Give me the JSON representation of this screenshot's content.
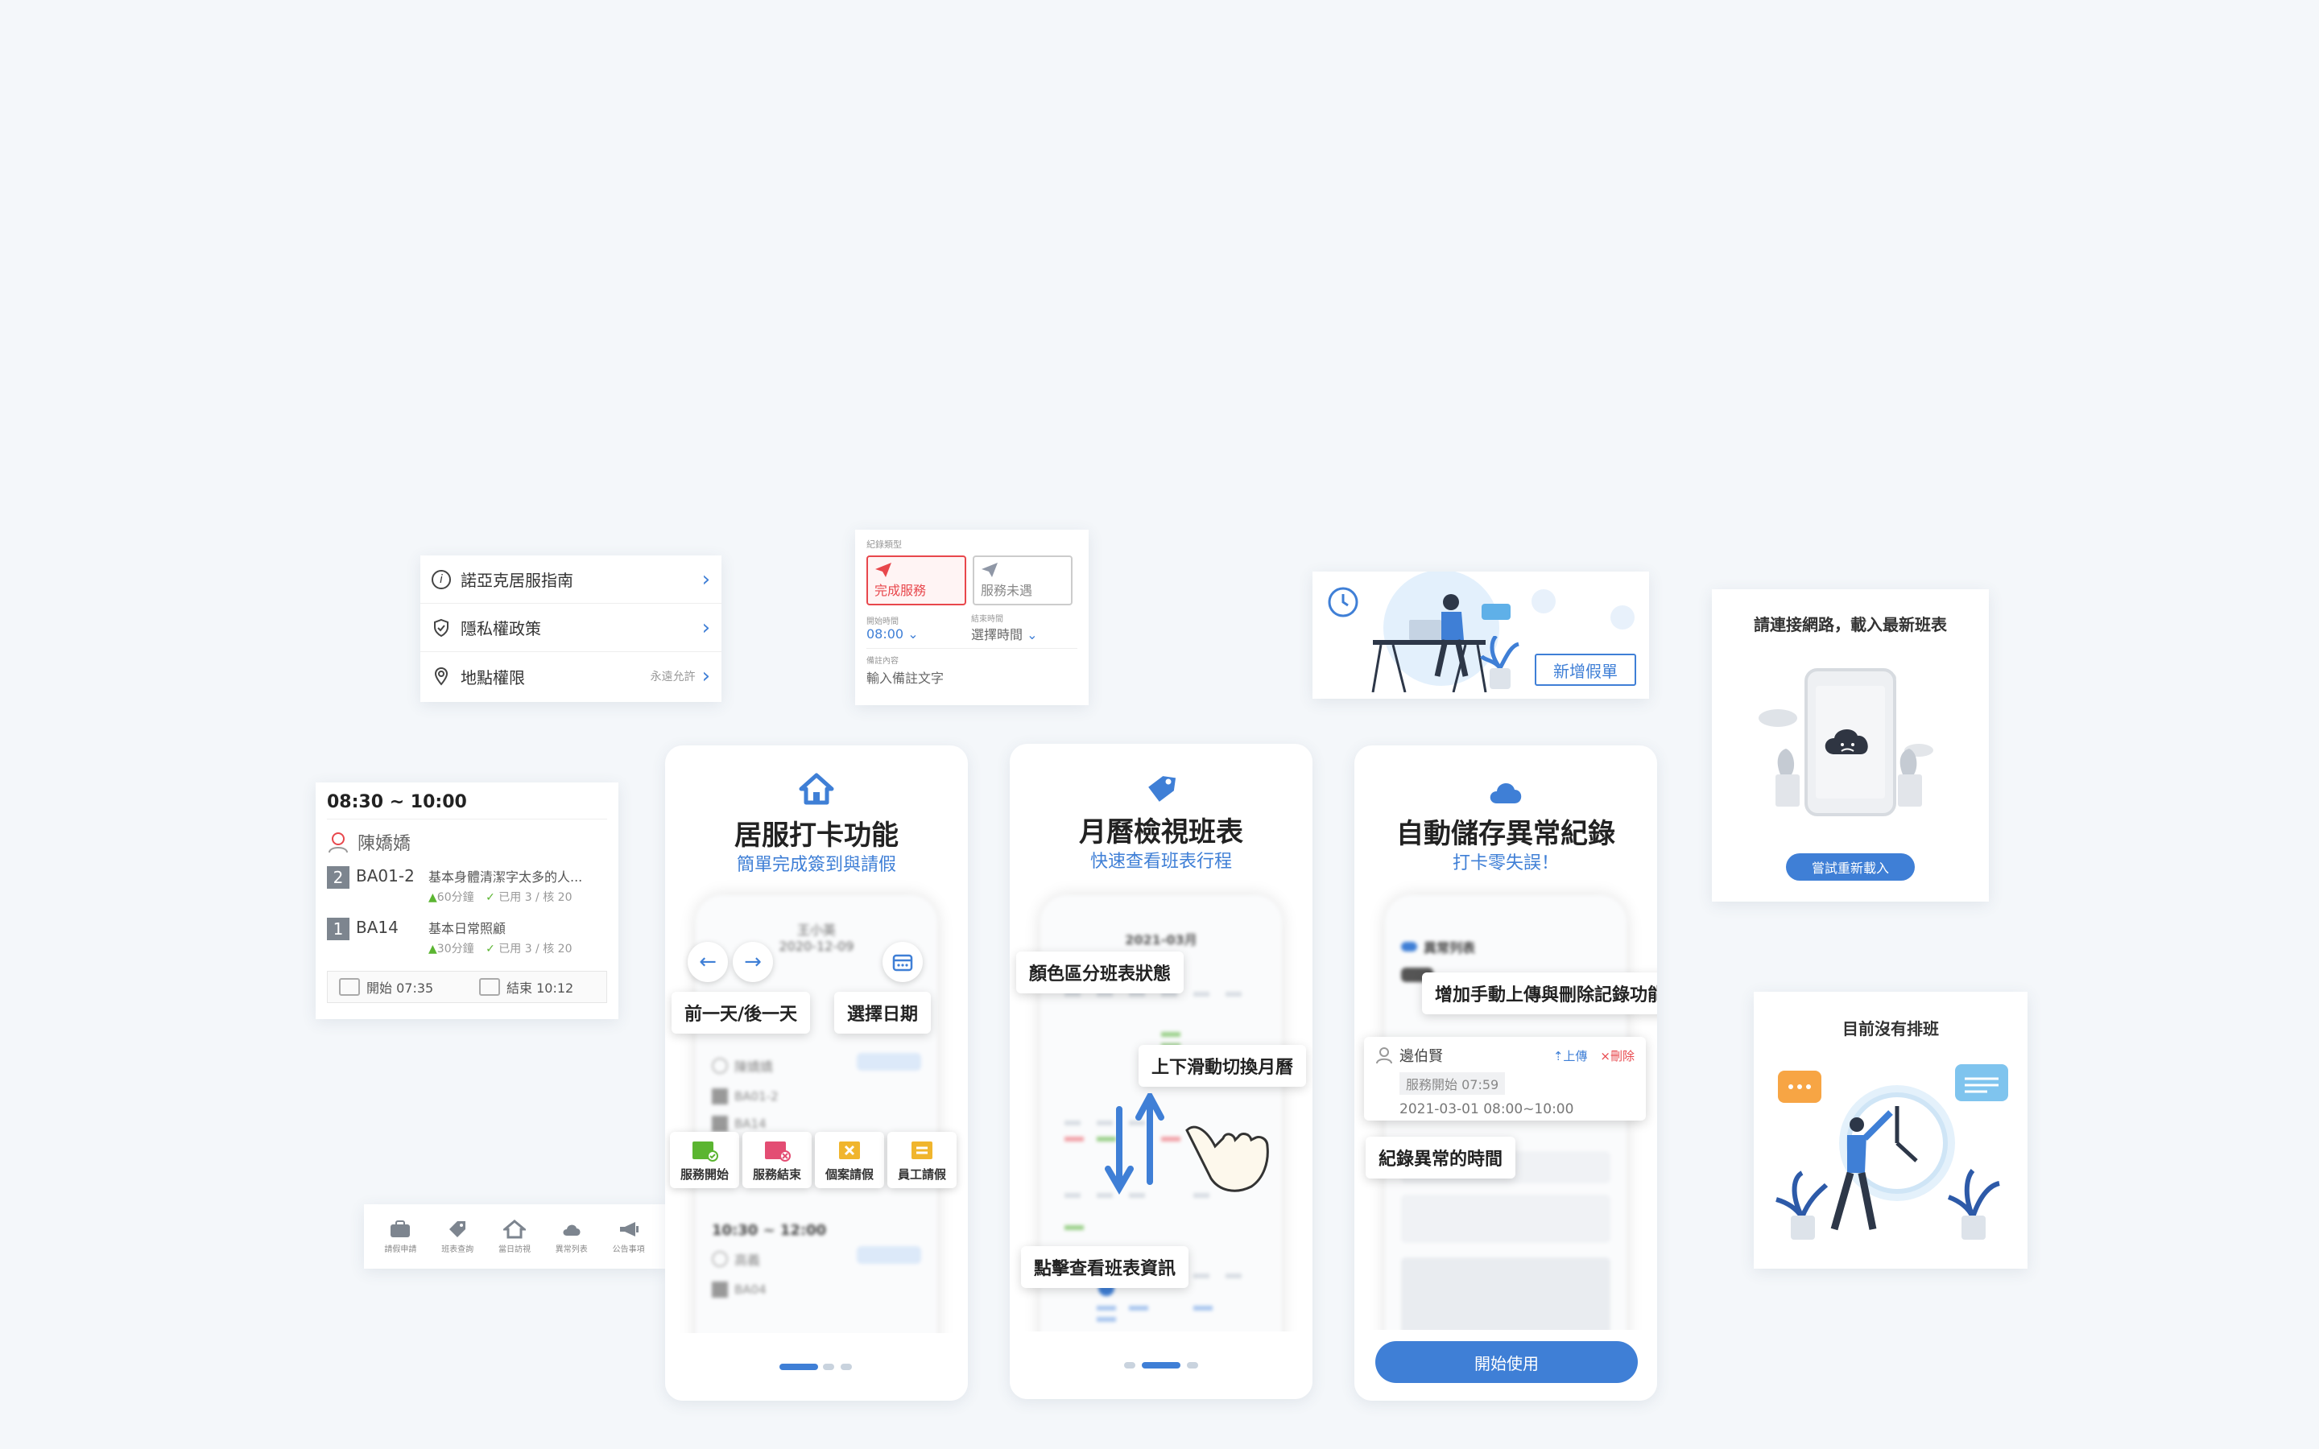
{
  "menu": {
    "items": [
      {
        "label": "諾亞克居服指南",
        "trail": ""
      },
      {
        "label": "隱私權政策",
        "trail": ""
      },
      {
        "label": "地點權限",
        "trail": "永遠允許"
      }
    ]
  },
  "record_form": {
    "type_label": "紀錄類型",
    "opt_done": "完成服務",
    "opt_missed": "服務未遇",
    "start_label": "開始時間",
    "start_value": "08:00",
    "end_label": "結束時間",
    "end_value": "選擇時間",
    "note_label": "備註內容",
    "note_placeholder": "輸入備註文字"
  },
  "leave_banner": {
    "button": "新增假單"
  },
  "offline": {
    "title": "請連接網路，載入最新班表",
    "button": "嘗試重新載入"
  },
  "empty": {
    "title": "目前沒有排班"
  },
  "schedule": {
    "time": "08:30 ~ 10:00",
    "client": "陳嬌嬌",
    "items": [
      {
        "count": "2",
        "code": "BA01-2",
        "desc": "基本身體清潔字太多的人...",
        "mins": "60分鐘",
        "used": "已用 3 / 核 20"
      },
      {
        "count": "1",
        "code": "BA14",
        "desc": "基本日常照顧",
        "mins": "30分鐘",
        "used": "已用 3 / 核 20"
      }
    ],
    "start": "開始 07:35",
    "end": "結束 10:12"
  },
  "tabbar": {
    "items": [
      "請假申請",
      "班表查詢",
      "當日訪視",
      "異常列表",
      "公告事項"
    ]
  },
  "phone1": {
    "title": "居服打卡功能",
    "subtitle": "簡單完成簽到與請假",
    "tip_prev_next": "前一天/後一天",
    "tip_pick_date": "選擇日期",
    "bg_name": "王小英",
    "bg_date": "2020-12-09",
    "bg_client": "陳嬌嬌",
    "bg_code1": "BA01-2",
    "bg_code2": "BA14",
    "bg_time2": "10:30 ~ 12:00",
    "bg_client2": "高義",
    "bg_code3": "BA04",
    "actions": [
      "服務開始",
      "服務結束",
      "個案請假",
      "員工請假"
    ]
  },
  "phone2": {
    "title": "月曆檢視班表",
    "subtitle": "快速查看班表行程",
    "bg_month": "2021-03月",
    "tip_color": "顏色區分班表狀態",
    "tip_swipe": "上下滑動切換月曆",
    "tip_tap": "點擊查看班表資訊"
  },
  "phone3": {
    "title": "自動儲存異常紀錄",
    "subtitle": "打卡零失誤！",
    "bg_header": "異常列表",
    "tip_upload": "增加手動上傳與刪除記錄功能",
    "name": "邊伯賢",
    "upload": "上傳",
    "delete": "刪除",
    "service": "服務開始 07:59",
    "datetime": "2021-03-01 08:00~10:00",
    "tip_record": "紀錄異常的時間",
    "start_button": "開始使用"
  },
  "colors": {
    "accent": "#3f7fd6",
    "danger": "#e8474c",
    "action_green": "#5bb531",
    "action_pink": "#e34d73",
    "action_yellow": "#f0b52d"
  }
}
